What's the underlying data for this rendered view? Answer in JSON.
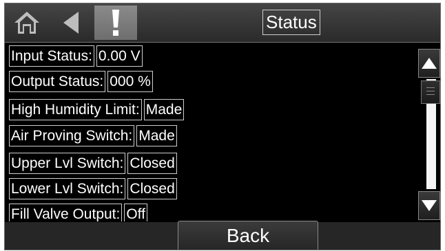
{
  "header": {
    "title": "Status",
    "icons": [
      "home-icon",
      "back-arrow-icon",
      "exclamation-icon"
    ]
  },
  "status_rows": [
    {
      "label": "Input Status:",
      "value": "0.00 V"
    },
    {
      "label": "Output Status:",
      "value": "000 %"
    },
    {
      "label": "High Humidity Limit:",
      "value": "Made"
    },
    {
      "label": "Air Proving Switch:",
      "value": "Made"
    },
    {
      "label": "Upper Lvl Switch:",
      "value": "Closed"
    },
    {
      "label": "Lower Lvl Switch:",
      "value": "Closed"
    },
    {
      "label": "Fill Valve Output:",
      "value": "Off"
    }
  ],
  "scroll": {
    "up_icon": "triangle-up-icon",
    "down_icon": "triangle-down-icon"
  },
  "footer": {
    "back_label": "Back"
  },
  "colors": {
    "background": "#000000",
    "text": "#ffffff",
    "border": "#cfcfcf",
    "alert_button": "#7a7a7a"
  }
}
